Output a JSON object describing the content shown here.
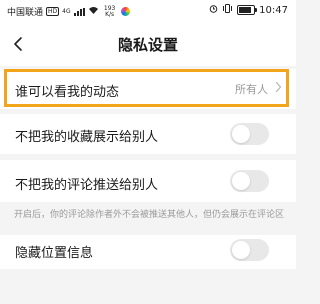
{
  "status_bar": {
    "carrier": "中国联通",
    "hd": "HD",
    "net": "4G",
    "speed_value": "193",
    "speed_unit": "K/s",
    "signal_icon": "signal-icon",
    "wifi_icon": "wifi-icon",
    "alarm_icon": "alarm-icon",
    "vibrate_icon": "vibrate-icon",
    "battery_level": 0.9,
    "time": "10:47"
  },
  "header": {
    "title": "隐私设置",
    "back_icon": "chevron-left-icon"
  },
  "settings": {
    "who_can_see": {
      "label": "谁可以看我的动态",
      "value": "所有人",
      "icon": "chevron-right-icon"
    },
    "hide_favorites": {
      "label": "不把我的收藏展示给别人",
      "enabled": false
    },
    "no_push_comments": {
      "label": "不把我的评论推送给别人",
      "enabled": false
    },
    "comment_note": "开启后，你的评论除作者外不会被推送其他人，但仍会展示在评论区",
    "hide_location": {
      "label": "隐藏位置信息",
      "enabled": false
    }
  },
  "colors": {
    "highlight_border": "#f2a51a",
    "toggle_off": "#e8e8e8",
    "background": "#f4f4f4",
    "secondary_text": "#9a9a9a"
  }
}
